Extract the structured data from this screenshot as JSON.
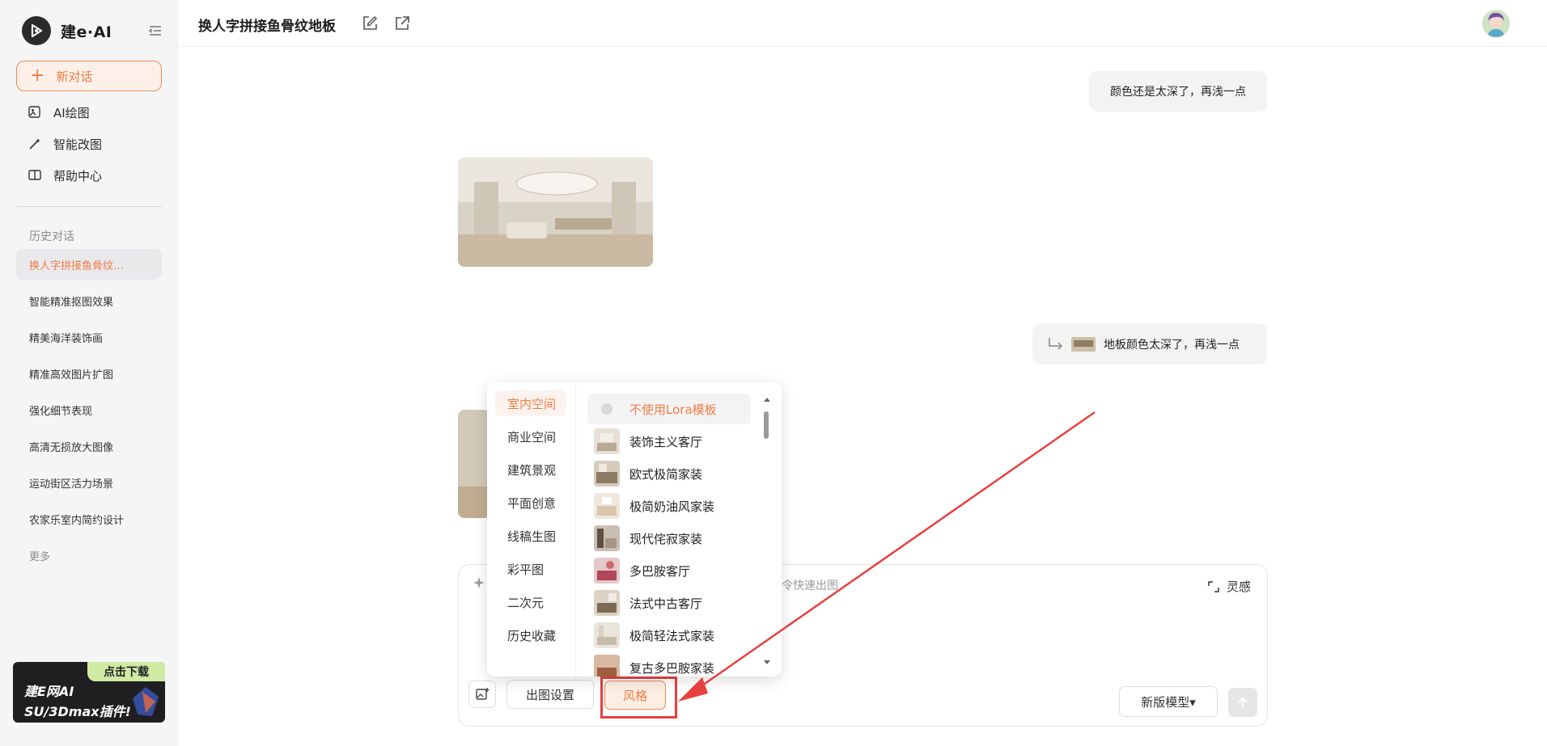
{
  "sidebar": {
    "brand": "建e·AI",
    "new_chat_label": "新对话",
    "nav": [
      {
        "label": "AI绘图",
        "icon": "ai-image-icon"
      },
      {
        "label": "智能改图",
        "icon": "magic-wand-icon"
      },
      {
        "label": "帮助中心",
        "icon": "book-icon"
      }
    ],
    "history_title": "历史对话",
    "history": [
      "换人字拼接鱼骨纹…",
      "智能精准抠图效果",
      "精美海洋装饰画",
      "精准高效图片扩图",
      "强化细节表现",
      "高清无损放大图像",
      "运动街区活力场景",
      "农家乐室内简约设计"
    ],
    "more_label": "更多",
    "promo": {
      "tag": "点击下载",
      "line1": "建E网AI",
      "line2": "SU/3Dmax插件!"
    }
  },
  "header": {
    "title": "换人字拼接鱼骨纹地板"
  },
  "messages": {
    "user1": "颜色还是太深了，再浅一点",
    "user2": "地板颜色太深了，再浅一点"
  },
  "composer": {
    "placeholder": "令快速出图",
    "inspire_label": "灵感",
    "settings_label": "出图设置",
    "style_label": "风格",
    "model_label": "新版模型▾"
  },
  "style_popup": {
    "categories": [
      "室内空间",
      "商业空间",
      "建筑景观",
      "平面创意",
      "线稿生图",
      "彩平图",
      "二次元",
      "历史收藏"
    ],
    "active_category": "室内空间",
    "loras": [
      "不使用Lora模板",
      "装饰主义客厅",
      "欧式极简家装",
      "极简奶油风家装",
      "现代侘寂家装",
      "多巴胺客厅",
      "法式中古客厅",
      "极简轻法式家装",
      "复古多巴胺家装"
    ]
  },
  "colors": {
    "accent": "#ef7d45",
    "annotation_red": "#e8403f"
  }
}
